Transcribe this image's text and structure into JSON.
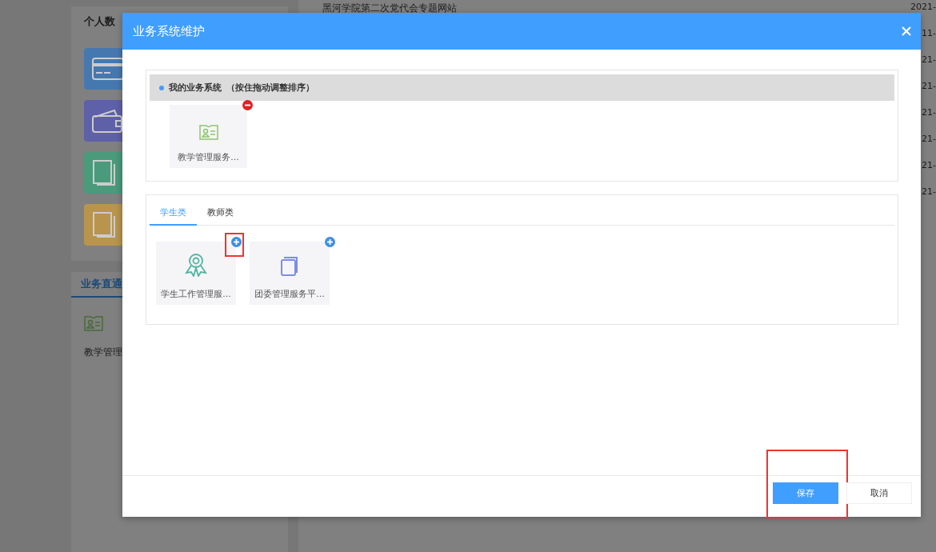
{
  "background": {
    "personal_card": {
      "title": "个人数",
      "tiles": [
        {
          "kind": "card",
          "color": "#4678b0"
        },
        {
          "kind": "wallet",
          "color": "#5e60a8"
        },
        {
          "kind": "book",
          "color": "#4a9a7c"
        },
        {
          "kind": "book",
          "color": "#b8944c"
        }
      ]
    },
    "direct_card": {
      "tab": "业务直通",
      "items": [
        {
          "label": "教学管理"
        }
      ]
    },
    "news": {
      "items": [
        {
          "title": "黑河学院第二次党代会专题网站",
          "date": "2021-"
        },
        {
          "date": "11-"
        },
        {
          "date": "21-"
        },
        {
          "date": "21-"
        },
        {
          "date": "21-"
        },
        {
          "date": "21-"
        },
        {
          "date": "21-"
        },
        {
          "date": "21-"
        }
      ]
    }
  },
  "dialog": {
    "title": "业务系统维护",
    "my_systems": {
      "heading": "我的业务系统",
      "hint": "（按住拖动调整排序）",
      "items": [
        {
          "label": "教学管理服务...",
          "kind": "id-card"
        }
      ]
    },
    "tabs": [
      {
        "label": "学生类",
        "selected": true
      },
      {
        "label": "教师类",
        "selected": false
      }
    ],
    "available": [
      {
        "label": "学生工作管理服...",
        "kind": "ribbon",
        "highlighted": true
      },
      {
        "label": "团委管理服务平...",
        "kind": "book",
        "highlighted": false
      }
    ],
    "buttons": [
      {
        "label": "保存",
        "kind": "primary",
        "highlighted": true
      },
      {
        "label": "取消",
        "kind": "default",
        "highlighted": false
      }
    ]
  }
}
